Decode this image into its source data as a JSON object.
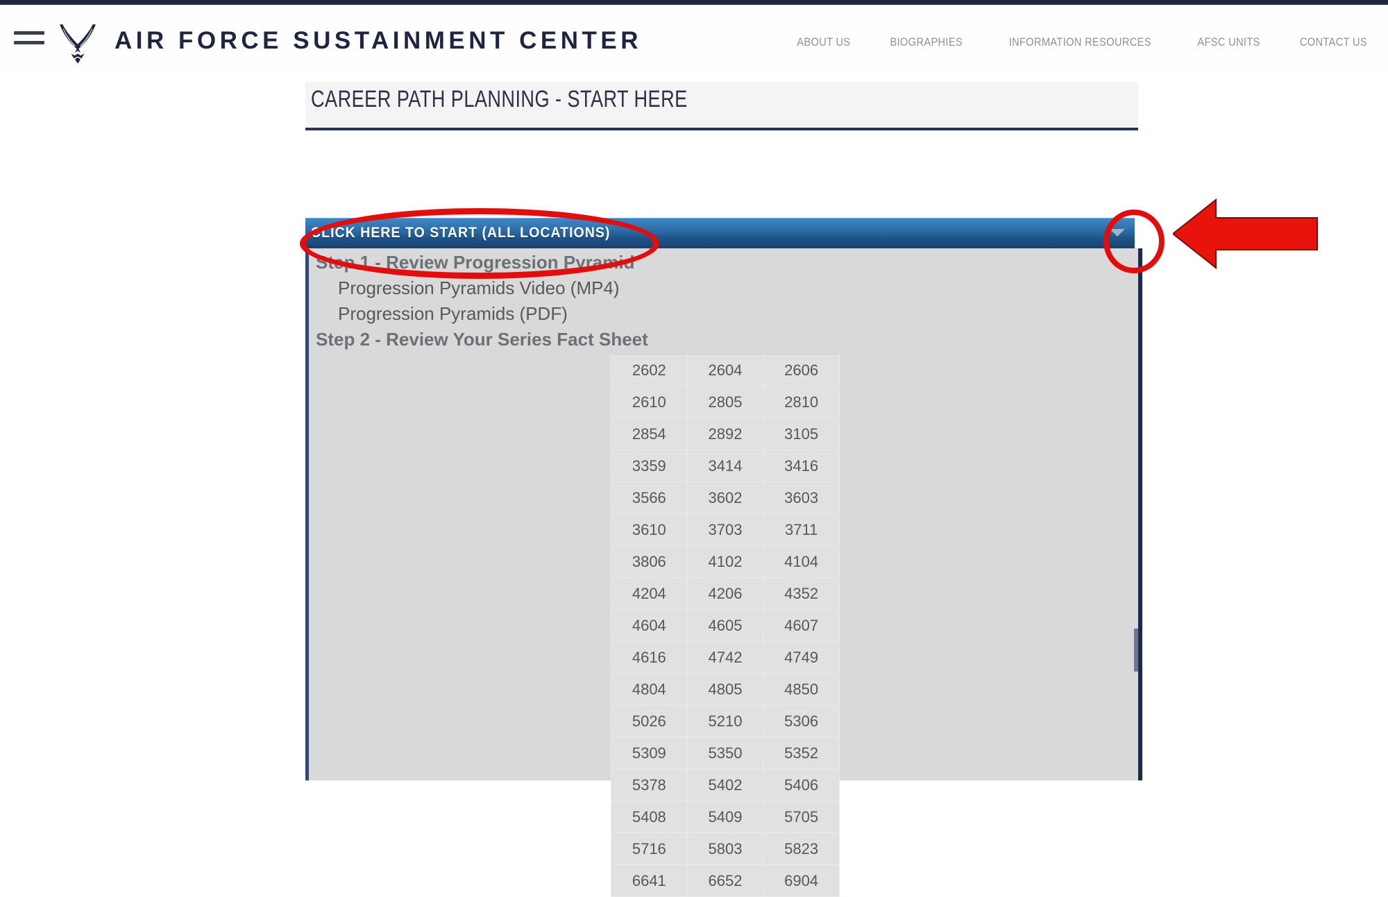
{
  "header": {
    "brand": "AIR FORCE SUSTAINMENT CENTER",
    "menu_icon": "hamburger-icon",
    "logo_icon": "air-force-wings-logo",
    "nav": [
      {
        "label": "ABOUT US"
      },
      {
        "label": "BIOGRAPHIES"
      },
      {
        "label": "INFORMATION RESOURCES"
      },
      {
        "label": "AFSC UNITS"
      },
      {
        "label": "CONTACT US"
      }
    ]
  },
  "panel": {
    "title": "CAREER PATH PLANNING - START HERE",
    "dropdown_label": "CLICK HERE TO START (ALL LOCATIONS)",
    "caret_icon": "chevron-down-icon",
    "steps": [
      {
        "label": "Step 1 - Review Progression Pyramid",
        "kind": "head"
      },
      {
        "label": "Progression Pyramids Video (MP4)",
        "kind": "sub"
      },
      {
        "label": "Progression Pyramids (PDF)",
        "kind": "sub"
      },
      {
        "label": "Step 2 - Review Your Series Fact Sheet",
        "kind": "head"
      }
    ],
    "series_rows": [
      [
        "2602",
        "2604",
        "2606"
      ],
      [
        "2610",
        "2805",
        "2810"
      ],
      [
        "2854",
        "2892",
        "3105"
      ],
      [
        "3359",
        "3414",
        "3416"
      ],
      [
        "3566",
        "3602",
        "3603"
      ],
      [
        "3610",
        "3703",
        "3711"
      ],
      [
        "3806",
        "4102",
        "4104"
      ],
      [
        "4204",
        "4206",
        "4352"
      ],
      [
        "4604",
        "4605",
        "4607"
      ],
      [
        "4616",
        "4742",
        "4749"
      ],
      [
        "4804",
        "4805",
        "4850"
      ],
      [
        "5026",
        "5210",
        "5306"
      ],
      [
        "5309",
        "5350",
        "5352"
      ],
      [
        "5378",
        "5402",
        "5406"
      ],
      [
        "5408",
        "5409",
        "5705"
      ],
      [
        "5716",
        "5803",
        "5823"
      ],
      [
        "6641",
        "6652",
        "6904"
      ]
    ]
  },
  "annotations": {
    "highlight_color": "#e20d0d",
    "ellipse_dropdown_label": "red-ellipse-around-dropdown-title",
    "ellipse_caret": "red-ellipse-around-chevron",
    "arrow": "red-arrow-pointing-left-at-chevron"
  },
  "colors": {
    "brand_navy": "#1f2541",
    "bar_blue": "#2d6ea8",
    "panel_gray": "#d9d9d9",
    "cell_gray": "#e1e1e1"
  }
}
